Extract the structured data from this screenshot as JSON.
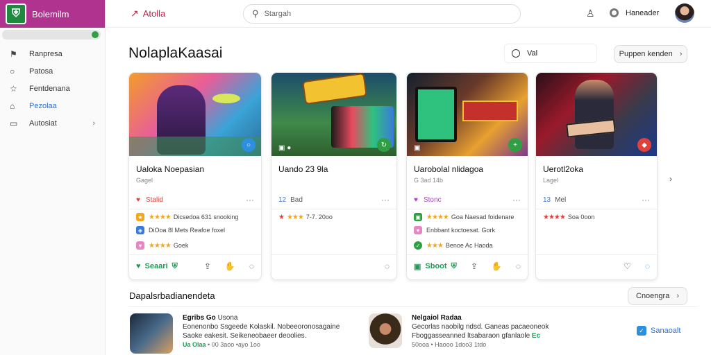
{
  "brand": {
    "title": "Bolemilm"
  },
  "sidebar": {
    "items": [
      {
        "label": "Ranpresa",
        "icon": "flag-icon"
      },
      {
        "label": "Patosa",
        "icon": "circle-icon"
      },
      {
        "label": "Fentdenana",
        "icon": "star-icon"
      },
      {
        "label": "Pezolaa",
        "icon": "home-icon"
      },
      {
        "label": "Autosiat",
        "icon": "square-icon"
      }
    ]
  },
  "header": {
    "app_name": "Atolla",
    "search_placeholder": "Stargah",
    "user_name": "Haneader"
  },
  "main": {
    "title": "NolaplaKaasai",
    "vol_label": "Val",
    "prev_button": "Puppen kenden"
  },
  "cards": [
    {
      "title": "Ualoka Noepasian",
      "subtitle": "Gagel",
      "meta_label": "Stalid",
      "rows": [
        "Dicsedoa 631 snooking",
        "DiOoa 8l Mets Reafoe foxel",
        "Goek"
      ],
      "footer": "Seaari"
    },
    {
      "title": "Uando 23 9la",
      "subtitle": "",
      "meta_label": "Bad",
      "meta_num": "12",
      "rows": [
        "7-7. 20oo"
      ],
      "footer": ""
    },
    {
      "title": "Uarobolal nlidagoa",
      "subtitle": "G 3ad  14b",
      "meta_label": "Stonc",
      "rows": [
        "Goa Naesad foidenare",
        "Enbbant koctoesat.  Gork",
        "Benoe Ac Haoda"
      ],
      "footer": "Sboot"
    },
    {
      "title": "Uerotl2oka",
      "subtitle": "Lagel",
      "meta_label": "Mel",
      "meta_num": "13",
      "rows": [
        "Soa 0oon"
      ],
      "footer": ""
    }
  ],
  "section": {
    "title": "Dapalsrbadianendeta",
    "button": "Cnoengra"
  },
  "list": [
    {
      "title": "Egribs Go",
      "title2": "Usona",
      "line1": "Eonenonbo Ssgeede Kolaskil. Nobeeoronosagaine",
      "line2": "Saoke eakesit. Seikeneobaeer deoolies.",
      "green": "Ua Olaa",
      "meta": "• 00  3aoo  •ayo 1oo"
    },
    {
      "title": "Nelgaiol Radaa",
      "title2": "",
      "line1": "Gecorlas naobilg ndsd. Ganeas pacaeoneok",
      "line2": "Fboggasseanned ltsabaraon gfanlaole",
      "green": "Ec",
      "meta": "50ooa  • Haooo  1doo3  1tdo"
    }
  ],
  "share_label": "Sanaoalt"
}
